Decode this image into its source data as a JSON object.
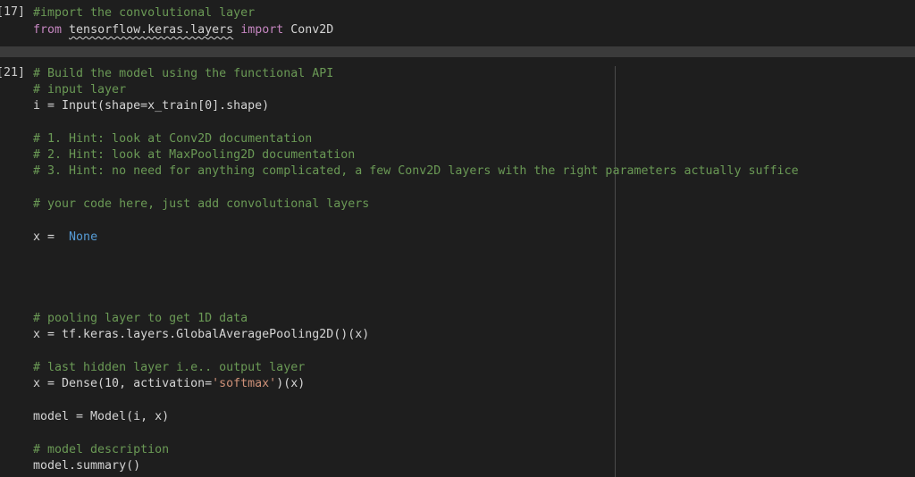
{
  "cells": {
    "import_cell": {
      "execution_count": "[17]",
      "lines": {
        "l1": "#import the convolutional layer",
        "l2_from": "from",
        "l2_module": "tensorflow.keras.layers",
        "l2_import": "import",
        "l2_name": "Conv2D"
      }
    },
    "model_cell": {
      "execution_count": "[21]",
      "lines": {
        "l1": "# Build the model using the functional API",
        "l2": "# input layer",
        "l3": "i = Input(shape=x_train[0].shape)",
        "l4": "# 1. Hint: look at Conv2D documentation",
        "l5": "# 2. Hint: look at MaxPooling2D documentation",
        "l6": "# 3. Hint: no need for anything complicated, a few Conv2D layers with the right parameters actually suffice",
        "l7": "# your code here, just add convolutional layers",
        "l8_lhs": "x = ",
        "l8_none": "None",
        "l9": "# pooling layer to get 1D data",
        "l10": "x = tf.keras.layers.GlobalAveragePooling2D()(x)",
        "l11": "# last hidden layer i.e.. output layer",
        "l12_a": "x = Dense(10, activation=",
        "l12_str": "'softmax'",
        "l12_b": ")(x)",
        "l13": "model = Model(i, x)",
        "l14": "# model description",
        "l15": "model.summary()"
      }
    }
  },
  "colors": {
    "background": "#1e1e1e",
    "separator": "#3b3b3b",
    "comment": "#6a9955",
    "keyword": "#c586c0",
    "constant": "#569cd6",
    "string": "#ce9178",
    "text": "#d4d4d4"
  }
}
